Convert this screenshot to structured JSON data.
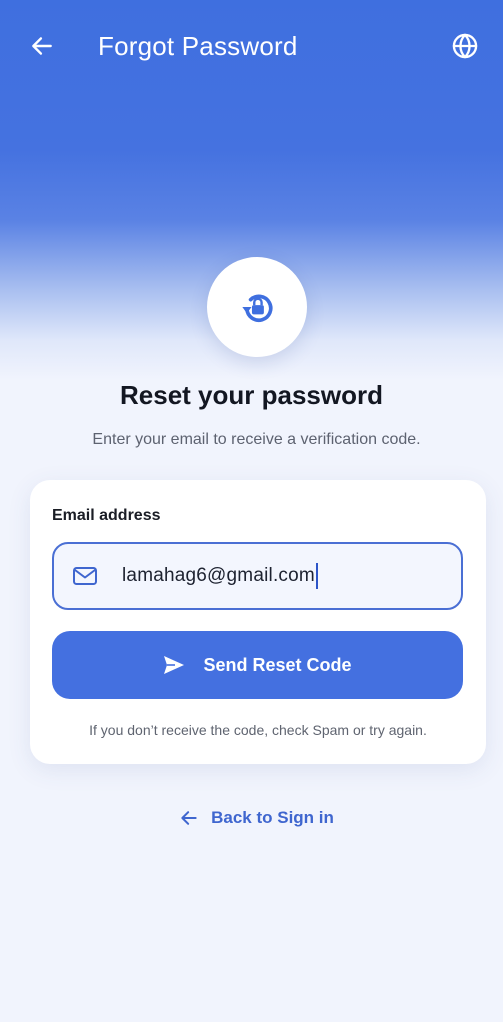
{
  "app_bar": {
    "title": "Forgot Password",
    "back_icon": "arrow-left-icon",
    "language_icon": "globe-icon"
  },
  "hero": {
    "icon": "lock-reset-icon",
    "heading": "Reset your password",
    "subtext": "Enter your email to receive a verification code."
  },
  "form": {
    "email_label": "Email address",
    "email_icon": "mail-icon",
    "email_value": "lamahag6@gmail.com",
    "send_button_icon": "send-icon",
    "send_button_label": "Send Reset Code",
    "hint": "If you don’t receive the code, check Spam or try again."
  },
  "footer": {
    "back_icon": "arrow-left-icon",
    "back_link_label": "Back to Sign in"
  },
  "colors": {
    "primary": "#4470e0",
    "header_blue": "#3f6fdf",
    "page_background": "#f1f4fd",
    "link": "#3f66cf"
  }
}
